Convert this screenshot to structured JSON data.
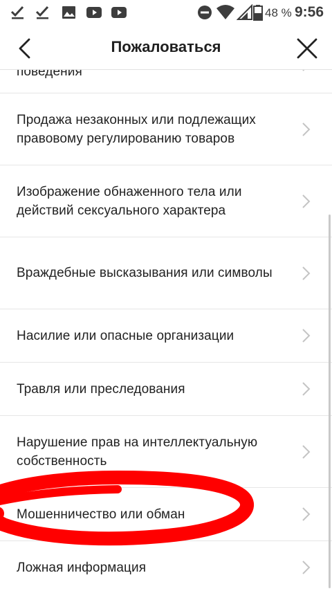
{
  "status_bar": {
    "icons": [
      "check-done-icon",
      "check-done-icon",
      "image-icon",
      "youtube-icon",
      "youtube-icon",
      "do-not-disturb-icon",
      "wifi-icon",
      "signal-icon",
      "battery-icon"
    ],
    "battery": "48 %",
    "time": "9:56"
  },
  "header": {
    "title": "Пожаловаться",
    "back_icon": "chevron-left-icon",
    "close_icon": "close-icon"
  },
  "list": {
    "items": [
      {
        "label": "поведения"
      },
      {
        "label": "Продажа незаконных или подлежащих правовому регулированию товаров"
      },
      {
        "label": "Изображение обнаженного тела или действий сексуального характера"
      },
      {
        "label": "Враждебные высказывания или символы"
      },
      {
        "label": "Насилие или опасные организации"
      },
      {
        "label": "Травля или преследования"
      },
      {
        "label": "Нарушение прав на интеллектуальную собственность"
      },
      {
        "label": "Мошенничество или обман"
      },
      {
        "label": "Ложная информация"
      }
    ]
  },
  "colors": {
    "text": "#222222",
    "divider": "#e6e6e6",
    "chevron": "#c4c4c4",
    "annotation": "#ff0000"
  }
}
